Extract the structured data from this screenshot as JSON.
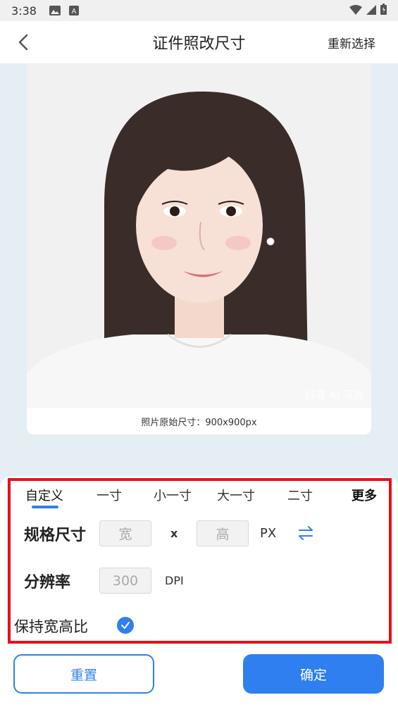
{
  "status_bar": {
    "time": "3:38",
    "icons": [
      "image-icon",
      "notification-a-icon",
      "wifi-icon",
      "signal-icon",
      "battery-icon"
    ]
  },
  "nav": {
    "back_icon": "chevron-left-icon",
    "title": "证件照改尺寸",
    "action": "重新选择"
  },
  "photo": {
    "watermark": "抖音 AI 写真",
    "caption": "照片原始尺寸：900x900px"
  },
  "tabs": {
    "items": [
      "自定义",
      "一寸",
      "小一寸",
      "大一寸",
      "二寸",
      "更多"
    ],
    "selected": "自定义"
  },
  "size_row": {
    "label": "规格尺寸",
    "width_placeholder": "宽",
    "height_placeholder": "高",
    "times": "x",
    "unit": "PX",
    "swap_icon": "swap-arrows-icon"
  },
  "resolution_row": {
    "label": "分辨率",
    "placeholder": "300",
    "unit": "DPI"
  },
  "keep_ratio": {
    "label": "保持宽高比",
    "checked": true
  },
  "buttons": {
    "reset": "重置",
    "confirm": "确定"
  },
  "colors": {
    "accent": "#2f7ff0",
    "highlight": "#e8101a",
    "preview_bg": "#e5eef3"
  }
}
